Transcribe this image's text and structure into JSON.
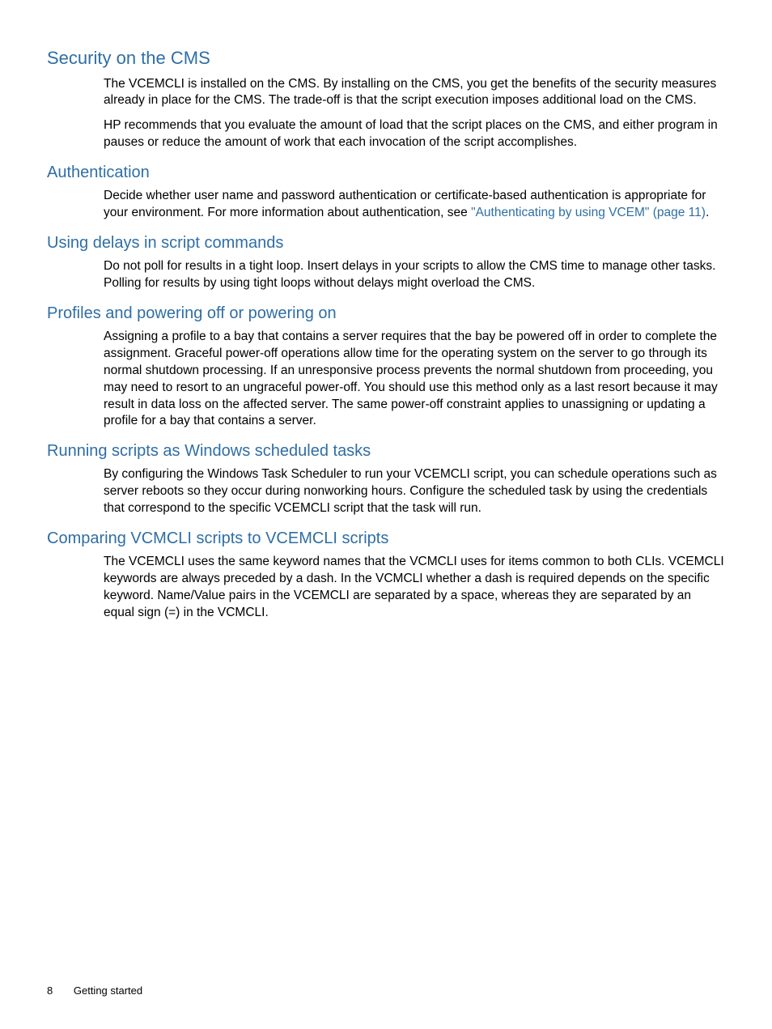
{
  "sections": {
    "sec1": {
      "heading": "Security on the CMS",
      "p1": "The VCEMCLI is installed on the CMS. By installing on the CMS, you get the benefits of the security measures already in place for the CMS. The trade-off is that the script execution imposes additional load on the CMS.",
      "p2": "HP recommends that you evaluate the amount of load that the script places on the CMS, and either program in pauses or reduce the amount of work that each invocation of the script accomplishes."
    },
    "sec2": {
      "heading": "Authentication",
      "p1a": "Decide whether user name and password authentication or certificate-based authentication is appropriate for your environment. For more information about authentication, see ",
      "link": "\"Authenticating by using VCEM\" (page 11)",
      "p1b": "."
    },
    "sec3": {
      "heading": "Using delays in script commands",
      "p1": "Do not poll for results in a tight loop. Insert delays in your scripts to allow the CMS time to manage other tasks. Polling for results by using tight loops without delays might overload the CMS."
    },
    "sec4": {
      "heading": "Profiles and powering off or powering on",
      "p1": "Assigning a profile to a bay that contains a server requires that the bay be powered off in order to complete the assignment. Graceful power-off operations allow time for the operating system on the server to go through its normal shutdown processing. If an unresponsive process prevents the normal shutdown from proceeding, you may need to resort to an ungraceful power-off. You should use this method only as a last resort because it may result in data loss on the affected server. The same power-off constraint applies to unassigning or updating a profile for a bay that contains a server."
    },
    "sec5": {
      "heading": "Running scripts as Windows scheduled tasks",
      "p1": "By configuring the Windows Task Scheduler to run your VCEMCLI script, you can schedule operations such as server reboots so they occur during nonworking hours. Configure the scheduled task by using the credentials that correspond to the specific VCEMCLI script that the task will run."
    },
    "sec6": {
      "heading": "Comparing VCMCLI scripts to VCEMCLI scripts",
      "p1": "The VCEMCLI uses the same keyword names that the VCMCLI uses for items common to both CLIs. VCEMCLI keywords are always preceded by a dash. In the VCMCLI whether a dash is required depends on the specific keyword. Name/Value pairs in the VCEMCLI are separated by a space, whereas they are separated by an equal sign (=) in the VCMCLI."
    }
  },
  "footer": {
    "page_number": "8",
    "chapter": "Getting started"
  }
}
